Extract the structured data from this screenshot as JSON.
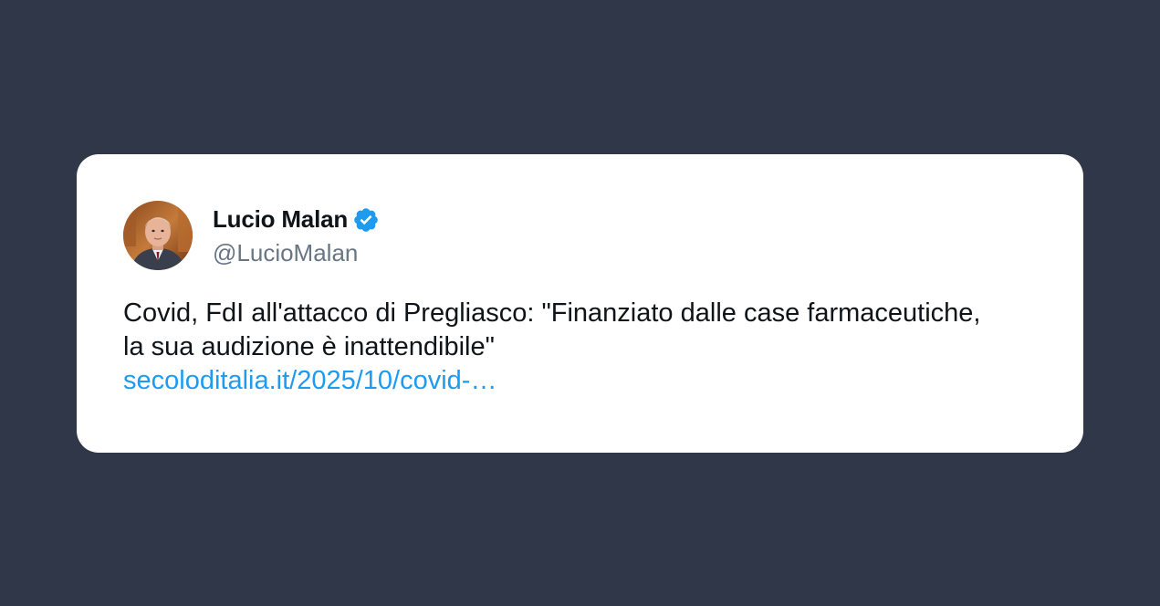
{
  "author": {
    "display_name": "Lucio Malan",
    "handle": "@LucioMalan",
    "avatar_icon": "avatar-photo",
    "verified_icon": "verified-badge-icon"
  },
  "tweet": {
    "text": "Covid, FdI all'attacco di Pregliasco: \"Finanziato dalle case farmaceutiche, la sua audizione è inattendibile\"",
    "link": "secoloditalia.it/2025/10/covid-…"
  },
  "colors": {
    "background": "#2f3748",
    "card": "#ffffff",
    "link": "#1d9bf0",
    "verified": "#1d9bf0",
    "handle": "#687684",
    "text": "#0f1419"
  }
}
